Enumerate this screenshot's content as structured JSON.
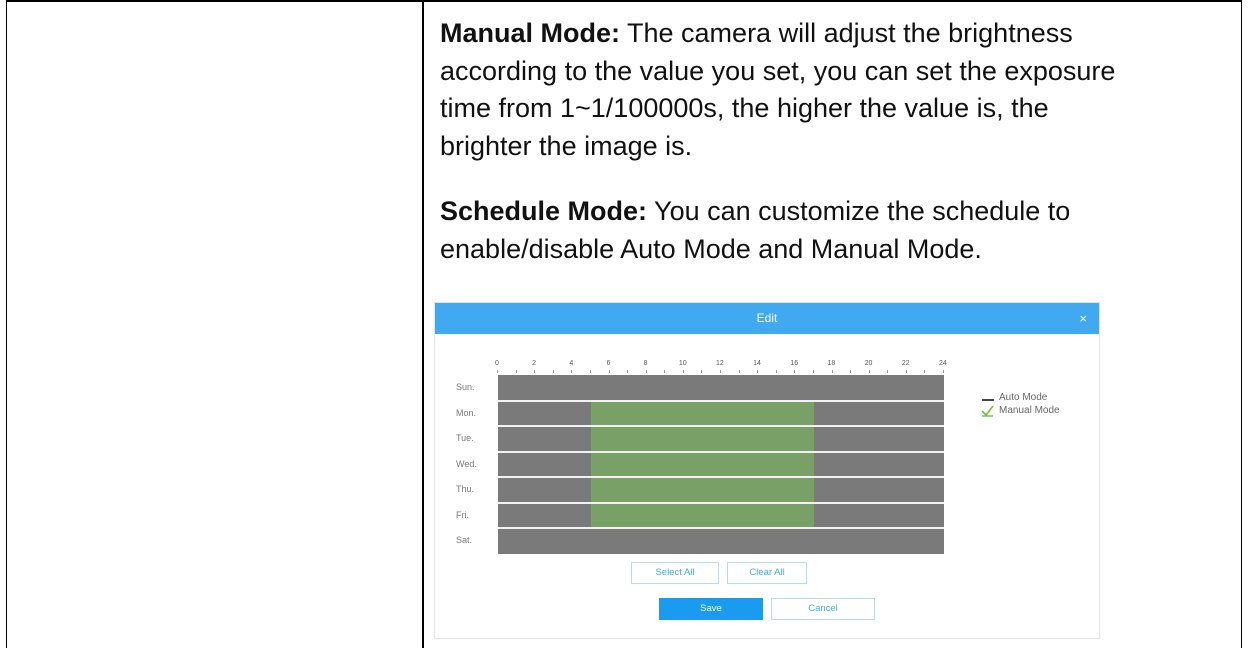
{
  "paragraphs": {
    "manual_mode": {
      "label": "Manual Mode:",
      "line1": " The camera will adjust the brightness",
      "line2": "according to the value you set, you can set the exposure",
      "line3": "time from 1~1/100000s, the higher the value is, the",
      "line4": "brighter the image is."
    },
    "schedule_mode": {
      "label": "Schedule Mode:",
      "line1": " You can customize the schedule to",
      "line2": "enable/disable Auto Mode and Manual Mode."
    }
  },
  "dialog": {
    "title": "Edit",
    "close_glyph": "×",
    "hours": [
      "0",
      "2",
      "4",
      "6",
      "8",
      "10",
      "12",
      "14",
      "16",
      "18",
      "20",
      "22",
      "24"
    ],
    "days": [
      "Sun.",
      "Mon.",
      "Tue.",
      "Wed.",
      "Thu.",
      "Fri.",
      "Sat."
    ],
    "schedule": {
      "Sun.": [],
      "Mon.": [
        [
          5,
          17
        ]
      ],
      "Tue.": [
        [
          5,
          17
        ]
      ],
      "Wed.": [
        [
          5,
          17
        ]
      ],
      "Thu.": [
        [
          5,
          17
        ]
      ],
      "Fri.": [
        [
          5,
          17
        ]
      ],
      "Sat.": []
    },
    "legend": {
      "auto_mode": "Auto Mode",
      "manual_mode": "Manual Mode",
      "auto_color": "#7a7a7a",
      "manual_color": "#79a067",
      "manual_icon": "checkmark-icon"
    },
    "buttons": {
      "select_all": "Select All",
      "clear_all": "Clear All",
      "save": "Save",
      "cancel": "Cancel"
    },
    "colors": {
      "header": "#41a9ef",
      "primary": "#1a9bef"
    }
  }
}
